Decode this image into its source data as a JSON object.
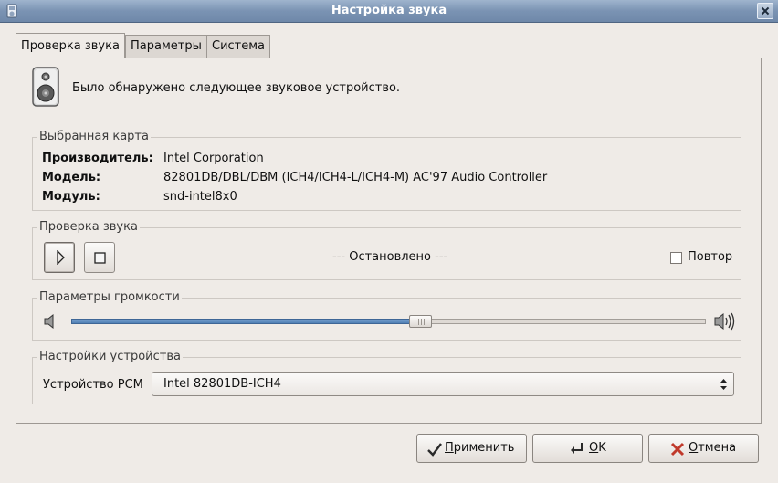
{
  "window": {
    "title": "Настройка звука"
  },
  "tabs": [
    {
      "label": "Проверка звука"
    },
    {
      "label": "Параметры"
    },
    {
      "label": "Система"
    }
  ],
  "detected_message": "Было обнаружено следующее звуковое устройство.",
  "selected_card": {
    "section_label": "Выбранная карта",
    "vendor_label": "Производитель:",
    "vendor_value": "Intel Corporation",
    "model_label": "Модель:",
    "model_value": "82801DB/DBL/DBM (ICH4/ICH4-L/ICH4-M) AC'97 Audio Controller",
    "module_label": "Модуль:",
    "module_value": "snd-intel8x0"
  },
  "sound_test": {
    "section_label": "Проверка звука",
    "status": "--- Остановлено ---",
    "repeat_label": "Повтор",
    "repeat_checked": false
  },
  "volume": {
    "section_label": "Параметры громкости",
    "level_fraction": 0.55
  },
  "device_settings": {
    "section_label": "Настройки устройства",
    "pcm_label": "Устройство PCM",
    "pcm_value": "Intel 82801DB-ICH4"
  },
  "buttons": {
    "apply_pre": "",
    "apply_mn": "П",
    "apply_post": "рименить",
    "ok_pre": "",
    "ok_mn": "O",
    "ok_post": "K",
    "cancel_pre": "",
    "cancel_mn": "О",
    "cancel_post": "тмена"
  },
  "icons": {
    "window_menu": "window-menu-icon",
    "close": "close-icon",
    "speaker": "speaker-device-icon",
    "play": "play-icon",
    "stop": "stop-icon",
    "volume_low": "volume-low-icon",
    "volume_high": "volume-high-icon",
    "apply": "checkmark-icon",
    "ok": "enter-arrow-icon",
    "cancel": "cross-icon"
  },
  "colors": {
    "titlebar": "#7a93b3",
    "slider_fill": "#4f7fb3",
    "cancel_icon": "#c0392b"
  }
}
